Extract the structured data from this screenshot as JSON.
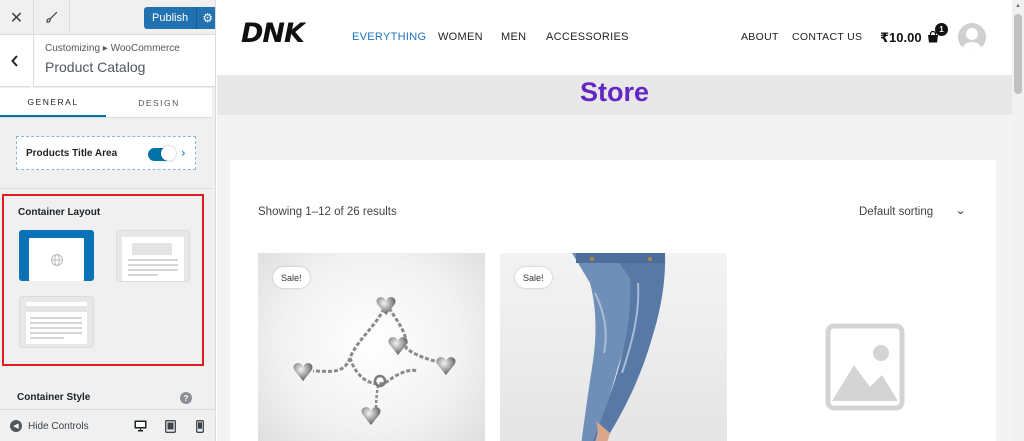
{
  "customizer": {
    "topbar": {
      "close_glyph": "✕",
      "publish_label": "Publish"
    },
    "breadcrumb": "Customizing ▸ WooCommerce",
    "panel_title": "Product Catalog",
    "tabs": [
      "GENERAL",
      "DESIGN"
    ],
    "active_tab": "GENERAL",
    "products_title_area": {
      "label": "Products Title Area",
      "enabled": true
    },
    "container_layout": {
      "label": "Container Layout",
      "selected_option": 1
    },
    "container_style": {
      "label": "Container Style",
      "help_glyph": "?"
    },
    "footer": {
      "hide_controls_label": "Hide Controls"
    },
    "accent_color": "#2271b1"
  },
  "site": {
    "logo": "DNK",
    "nav_left": [
      "EVERYTHING",
      "WOMEN",
      "MEN",
      "ACCESSORIES"
    ],
    "nav_active": "EVERYTHING",
    "nav_right": [
      "ABOUT",
      "CONTACT US"
    ],
    "cart_total": "₹10.00",
    "cart_count": "1",
    "page_title": "Store",
    "title_color": "#6328c4",
    "result_count": "Showing 1–12 of 26 results",
    "sorting": "Default sorting",
    "products": [
      {
        "sale_badge": "Sale!",
        "image": "heart-charm-bracelet"
      },
      {
        "sale_badge": "Sale!",
        "image": "blue-jeans"
      },
      {
        "sale_badge": "",
        "image": "placeholder-image-icon"
      }
    ]
  }
}
